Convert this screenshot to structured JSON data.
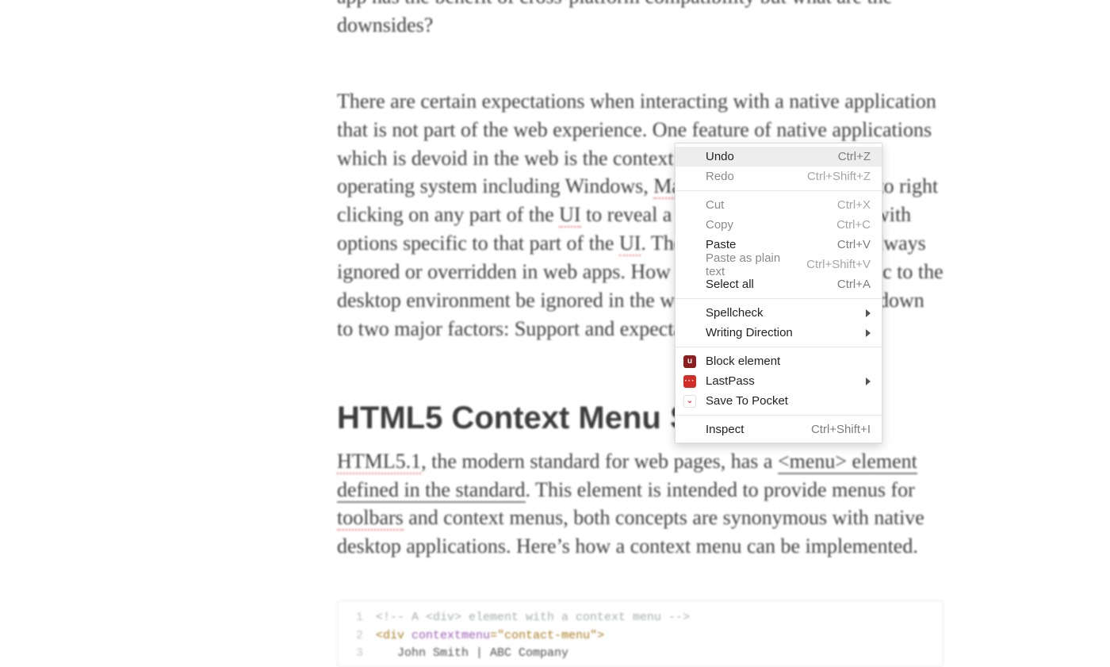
{
  "article": {
    "p0": "app has the benefit of cross-platform compatibility but what are the downsides?",
    "p1_a": "There are certain expectations when interacting with a native application that is not part of the web experience. One feature of native applications which is devoid in the web is the context menu. A user, on every operating system including Windows, ",
    "p1_macos": "MacOS",
    "p1_b": " and Linux, is used to right clicking on any part of the ",
    "p1_ui1": "UI",
    "p1_c": " to reveal a context menu—a menu with options specific to that part of the ",
    "p1_ui2": "UI",
    "p1_d": ". The ‘right click’ is almost always ignored or overridden in web apps. How can something so intrinsic to the desktop environment be ignored in the web experience? It comes down to two major factors: Support and expectation.",
    "heading": "HTML5 Context Menu Support",
    "p2_html51": "HTML5.1",
    "p2_a": ", the modern standard for web pages, has a ",
    "p2_menu": "<menu> element defined in the standard",
    "p2_b": ". This element is intended to provide menus for ",
    "p2_toolbars": "toolbars",
    "p2_c": " and context menus, both concepts are synonymous with native desktop applications. Here’s how a context menu can be implemented."
  },
  "code": {
    "l1": "<!-- A <div> element with a context menu -->",
    "l2a": "<div",
    "l2b": "contextmenu",
    "l2c": "=\"contact-menu\">",
    "l3": "   John Smith | ABC Company"
  },
  "menu": {
    "items": [
      {
        "label": "Undo",
        "shortcut": "Ctrl+Z",
        "disabled": false,
        "hover": true
      },
      {
        "label": "Redo",
        "shortcut": "Ctrl+Shift+Z",
        "disabled": true
      },
      {
        "sep": true
      },
      {
        "label": "Cut",
        "shortcut": "Ctrl+X",
        "disabled": true
      },
      {
        "label": "Copy",
        "shortcut": "Ctrl+C",
        "disabled": true
      },
      {
        "label": "Paste",
        "shortcut": "Ctrl+V",
        "disabled": false
      },
      {
        "label": "Paste as plain text",
        "shortcut": "Ctrl+Shift+V",
        "disabled": true
      },
      {
        "label": "Select all",
        "shortcut": "Ctrl+A",
        "disabled": false
      },
      {
        "sep": true
      },
      {
        "label": "Spellcheck",
        "submenu": true
      },
      {
        "label": "Writing Direction",
        "submenu": true
      },
      {
        "sep": true
      },
      {
        "label": "Block element",
        "icon": "ublock"
      },
      {
        "label": "LastPass",
        "icon": "lastpass",
        "submenu": true
      },
      {
        "label": "Save To Pocket",
        "icon": "pocket"
      },
      {
        "sep": true
      },
      {
        "label": "Inspect",
        "shortcut": "Ctrl+Shift+I"
      }
    ]
  }
}
